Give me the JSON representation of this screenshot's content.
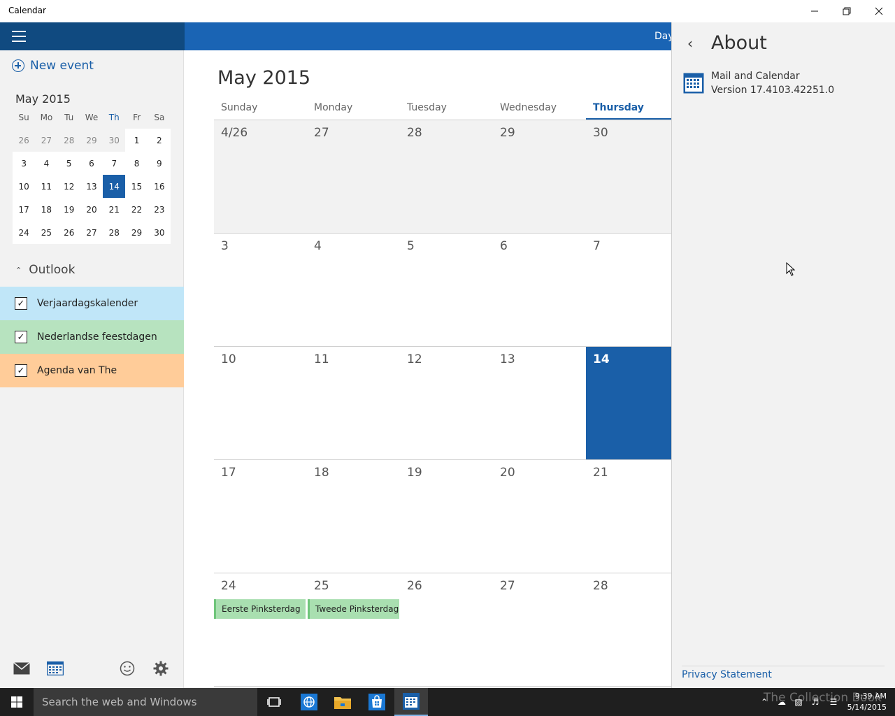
{
  "window": {
    "title": "Calendar"
  },
  "sidebar": {
    "new_event": "New event",
    "mini_month_label": "May 2015",
    "weekday_short": [
      "Su",
      "Mo",
      "Tu",
      "We",
      "Th",
      "Fr",
      "Sa"
    ],
    "mini_weeks": [
      [
        "26",
        "27",
        "28",
        "29",
        "30",
        "1",
        "2"
      ],
      [
        "3",
        "4",
        "5",
        "6",
        "7",
        "8",
        "9"
      ],
      [
        "10",
        "11",
        "12",
        "13",
        "14",
        "15",
        "16"
      ],
      [
        "17",
        "18",
        "19",
        "20",
        "21",
        "22",
        "23"
      ],
      [
        "24",
        "25",
        "26",
        "27",
        "28",
        "29",
        "30"
      ]
    ],
    "outlook_label": "Outlook",
    "calendars": [
      {
        "name": "Verjaardagskalender",
        "color": "#c0e6f8"
      },
      {
        "name": "Nederlandse feestdagen",
        "color": "#b7e3bf"
      },
      {
        "name": "Agenda van The",
        "color": "#ffcc99"
      }
    ]
  },
  "main": {
    "view_button": "Day",
    "month_title": "May 2015",
    "weekdays": [
      "Sunday",
      "Monday",
      "Tuesday",
      "Wednesday",
      "Thursday"
    ],
    "weeks": [
      [
        "4/26",
        "27",
        "28",
        "29",
        "30"
      ],
      [
        "3",
        "4",
        "5",
        "6",
        "7"
      ],
      [
        "10",
        "11",
        "12",
        "13",
        "14"
      ],
      [
        "17",
        "18",
        "19",
        "20",
        "21"
      ],
      [
        "24",
        "25",
        "26",
        "27",
        "28"
      ]
    ],
    "events": [
      "Eerste Pinksterdag",
      "Tweede Pinksterdag"
    ]
  },
  "about": {
    "title": "About",
    "app_name": "Mail and Calendar",
    "version": "Version 17.4103.42251.0",
    "privacy": "Privacy Statement"
  },
  "taskbar": {
    "search_placeholder": "Search the web and Windows",
    "time": "9:39 AM",
    "date": "5/14/2015",
    "watermark": "The Collection Book"
  },
  "colors": {
    "accent": "#1a64b4",
    "dark_accent": "#104a80"
  }
}
